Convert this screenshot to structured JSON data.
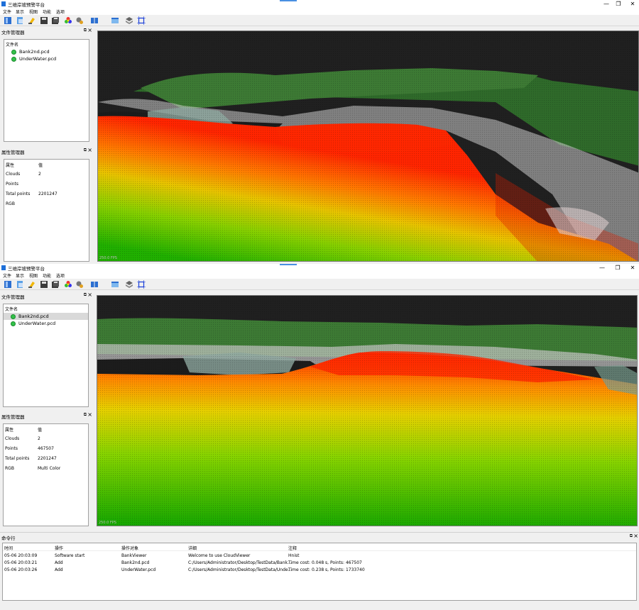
{
  "app": {
    "title": "三维岸坡预警平台",
    "window_controls": [
      "—",
      "❐",
      "✕"
    ],
    "menu": [
      "文件",
      "显示",
      "视图",
      "功能",
      "选项"
    ]
  },
  "toolbar_icons": [
    "open-file-icon",
    "import-icon",
    "clear-icon",
    "save-icon",
    "save-all-icon",
    "color-wheel-icon",
    "settings-icon",
    "split-view-icon",
    "cube-view-icon",
    "layers-icon",
    "bounding-box-icon"
  ],
  "colors": {
    "accent": "#1e6fd8",
    "dot_green": "#33c24a",
    "viewport_bg": "#202020",
    "height_high": "#ff2000",
    "height_mid": "#ffd000",
    "height_low": "#40c000"
  },
  "top_window": {
    "file_manager": {
      "title": "文件管理器",
      "header": "文件名",
      "files": [
        "Bank2nd.pcd",
        "UnderWater.pcd"
      ]
    },
    "property_manager": {
      "title": "属性管理器",
      "col_name": "属性",
      "col_value": "值",
      "rows": [
        {
          "name": "Clouds",
          "value": "2"
        },
        {
          "name": "Points",
          "value": ""
        },
        {
          "name": "Total points",
          "value": "2201247"
        },
        {
          "name": "RGB",
          "value": ""
        }
      ]
    },
    "fps": "250.0 FPS"
  },
  "bottom_window": {
    "file_manager": {
      "title": "文件管理器",
      "header": "文件名",
      "files": [
        "Bank2nd.pcd",
        "UnderWater.pcd"
      ],
      "selected": "Bank2nd.pcd"
    },
    "property_manager": {
      "title": "属性管理器",
      "col_name": "属性",
      "col_value": "值",
      "rows": [
        {
          "name": "Clouds",
          "value": "2"
        },
        {
          "name": "Points",
          "value": "467507"
        },
        {
          "name": "Total points",
          "value": "2201247"
        },
        {
          "name": "RGB",
          "value": "Multi Color"
        }
      ]
    },
    "fps": "250.0 FPS",
    "command_panel": {
      "title": "命令行",
      "columns": [
        "时间",
        "操作",
        "操作对象",
        "详细",
        "注释"
      ],
      "rows": [
        {
          "time": "05-06 20:03:09",
          "op": "Software start",
          "target": "BankViewer",
          "detail": "Welcome to use CloudViewer",
          "note": "Hnist"
        },
        {
          "time": "05-06 20:03:21",
          "op": "Add",
          "target": "Bank2nd.pcd",
          "detail": "C:/Users/Administrator/Desktop/TestData/Bank...",
          "note": "Time cost: 0.048 s, Points: 467507"
        },
        {
          "time": "05-06 20:03:26",
          "op": "Add",
          "target": "UnderWater.pcd",
          "detail": "C:/Users/Administrator/Desktop/TestData/Unde...",
          "note": "Time cost: 0.238 s, Points: 1733740"
        }
      ]
    }
  }
}
